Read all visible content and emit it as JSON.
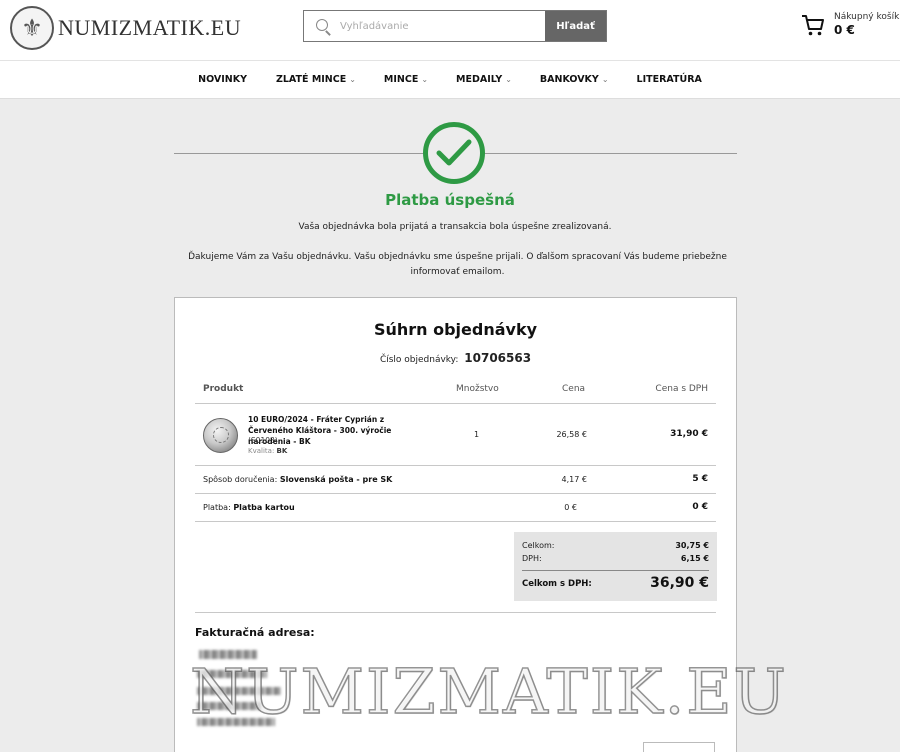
{
  "header": {
    "logo_text": "NUMIZMATIK.EU",
    "search": {
      "placeholder": "Vyhľadávanie",
      "button_label": "Hľadať"
    },
    "cart": {
      "label": "Nákupný košík",
      "amount": "0 €"
    }
  },
  "nav": {
    "items": [
      {
        "label": "NOVINKY",
        "has_dropdown": false
      },
      {
        "label": "ZLATÉ MINCE",
        "has_dropdown": true
      },
      {
        "label": "MINCE",
        "has_dropdown": true
      },
      {
        "label": "MEDAILY",
        "has_dropdown": true
      },
      {
        "label": "BANKOVKY",
        "has_dropdown": true
      },
      {
        "label": "LITERATÚRA",
        "has_dropdown": false
      }
    ]
  },
  "success": {
    "title": "Platba úspešná",
    "message": "Vaša objednávka bola prijatá a transakcia bola úspešne zrealizovaná.",
    "thanks": "Ďakujeme Vám za Vašu objednávku. Vašu objednávku sme úspešne prijali. O ďalšom spracovaní Vás budeme priebežne informovať emailom."
  },
  "summary": {
    "title": "Súhrn objednávky",
    "order_number_label": "Číslo objednávky:",
    "order_number": "10706563",
    "columns": {
      "product": "Produkt",
      "quantity": "Množstvo",
      "price": "Cena",
      "price_vat": "Cena s DPH"
    },
    "product": {
      "name": "10 EURO/2024 - Fráter Cyprián z Červeného Kláštora - 300. výročie narodenia - BK",
      "code": "(S0103)",
      "quality_label": "Kvalita:",
      "quality": "BK",
      "quantity": "1",
      "price": "26,58 €",
      "price_vat": "31,90 €"
    },
    "delivery": {
      "label": "Spôsob doručenia:",
      "value": "Slovenská pošta - pre SK",
      "price": "4,17 €",
      "price_vat": "5 €"
    },
    "payment": {
      "label": "Platba:",
      "value": "Platba kartou",
      "price": "0 €",
      "price_vat": "0 €"
    },
    "totals": {
      "total_label": "Celkom:",
      "total": "30,75 €",
      "vat_label": "DPH:",
      "vat": "6,15 €",
      "grand_label": "Celkom s DPH:",
      "grand": "36,90 €"
    },
    "billing_title": "Fakturačná adresa:"
  },
  "watermark": "NUMIZMATIK.EU",
  "colors": {
    "success_green": "#2e9a44",
    "search_button": "#666666"
  }
}
